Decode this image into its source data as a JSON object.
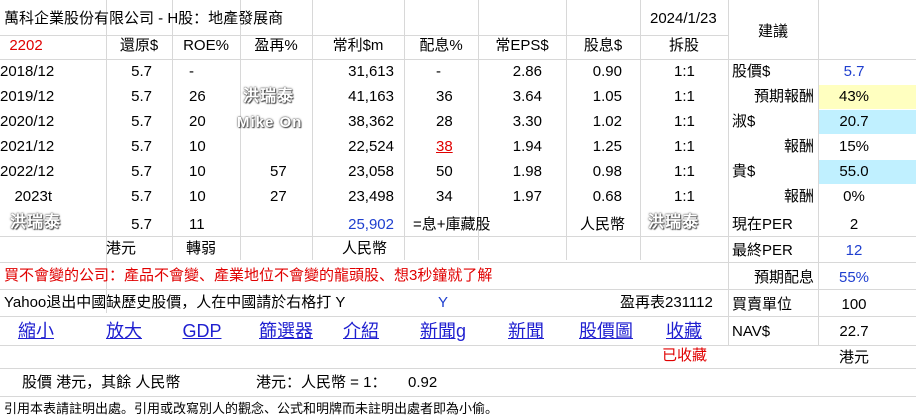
{
  "header": {
    "company": "萬科企業股份有限公司 - H股：地產發展商",
    "date": "2024/1/23",
    "advice_title": "建議"
  },
  "columns": {
    "code": "2202",
    "restored": "還原$",
    "roe": "ROE%",
    "pe": "盈再%",
    "profit": "常利$m",
    "payout": "配息%",
    "eps": "常EPS$",
    "dividend": "股息$",
    "split": "拆股"
  },
  "rows": [
    {
      "year": "2018/12",
      "restored": "5.7",
      "roe": "-",
      "pe": "",
      "profit": "31,613",
      "payout": "-",
      "eps": "2.86",
      "dividend": "0.90",
      "split": "1:1"
    },
    {
      "year": "2019/12",
      "restored": "5.7",
      "roe": "26",
      "pe": "",
      "profit": "41,163",
      "payout": "36",
      "eps": "3.64",
      "dividend": "1.05",
      "split": "1:1"
    },
    {
      "year": "2020/12",
      "restored": "5.7",
      "roe": "20",
      "pe": "",
      "profit": "38,362",
      "payout": "28",
      "eps": "3.30",
      "dividend": "1.02",
      "split": "1:1"
    },
    {
      "year": "2021/12",
      "restored": "5.7",
      "roe": "10",
      "pe": "",
      "profit": "22,524",
      "payout": "38",
      "eps": "1.94",
      "dividend": "1.25",
      "split": "1:1"
    },
    {
      "year": "2022/12",
      "restored": "5.7",
      "roe": "10",
      "pe": "57",
      "profit": "23,058",
      "payout": "50",
      "eps": "1.98",
      "dividend": "0.98",
      "split": "1:1"
    },
    {
      "year": "2023t",
      "restored": "5.7",
      "roe": "10",
      "pe": "27",
      "profit": "23,498",
      "payout": "34",
      "eps": "1.97",
      "dividend": "0.68",
      "split": "1:1"
    }
  ],
  "summary": {
    "restored": "5.7",
    "roe": "11",
    "profit": "25,902",
    "profit_note": "=息+庫藏股",
    "currency_right": "人民幣",
    "hkd": "港元",
    "roe_trend": "轉弱",
    "rmb": "人民幣"
  },
  "advice": [
    {
      "label": "股價$",
      "value": "5.7"
    },
    {
      "label": "預期報酬",
      "value": "43%"
    },
    {
      "label": "淑$",
      "value": "20.7"
    },
    {
      "label": "報酬",
      "value": "15%"
    },
    {
      "label": "貴$",
      "value": "55.0"
    },
    {
      "label": "報酬",
      "value": "0%"
    },
    {
      "label": "現在PER",
      "value": "2"
    },
    {
      "label": "最終PER",
      "value": "12"
    },
    {
      "label": "預期配息",
      "value": "55%"
    },
    {
      "label": "買賣單位",
      "value": "100"
    },
    {
      "label": "NAV$",
      "value": "22.7"
    },
    {
      "label": "",
      "value": "港元"
    }
  ],
  "watermark": {
    "name": "洪瑞泰",
    "sub": "Mike On"
  },
  "notes": {
    "slogan": "買不會變的公司：產品不會變、產業地位不會變的龍頭股、想3秒鐘就了解",
    "yahoo": "Yahoo退出中國缺歷史股價，人在中國請於右格打 Y",
    "yahoo_value": "Y",
    "table_ref": "盈再表231112",
    "collected": "已收藏",
    "currency_note": "股價 港元，其餘 人民幣",
    "fx_label": "港元：人民幣 = 1：",
    "fx_value": "0.92",
    "footer": "引用本表請註明出處。引用或改寫別人的觀念、公式和明牌而未註明出處者即為小偷。"
  },
  "links": [
    "縮小",
    "放大",
    "GDP",
    "篩選器",
    "介紹",
    "新聞g",
    "新聞",
    "股價圖",
    "收藏"
  ],
  "colors": {
    "yellow": "#ffffc0",
    "cyan": "#c0f0ff",
    "red": "#e00000",
    "blue": "#1f3fcf"
  }
}
